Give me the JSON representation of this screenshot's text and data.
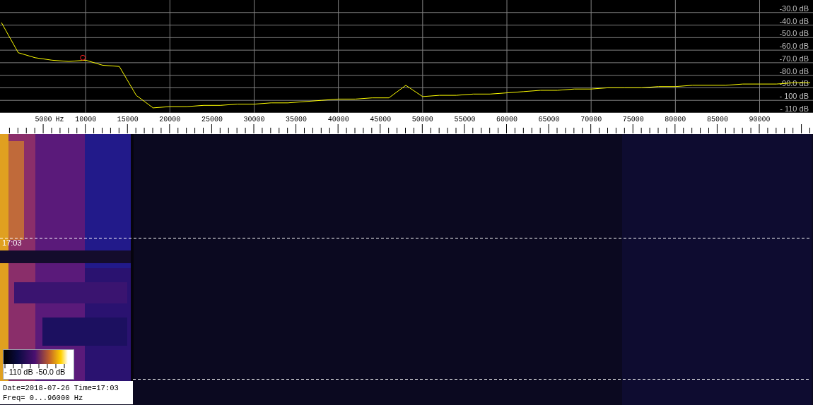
{
  "spectrum": {
    "chart_data": {
      "type": "line",
      "xlabel": "Hz",
      "x": [
        0,
        2000,
        4000,
        6000,
        8000,
        10000,
        12000,
        14000,
        16000,
        18000,
        20000,
        22000,
        24000,
        26000,
        28000,
        30000,
        32000,
        34000,
        36000,
        38000,
        40000,
        42000,
        44000,
        46000,
        48000,
        50000,
        52000,
        54000,
        56000,
        58000,
        60000,
        62000,
        64000,
        66000,
        68000,
        70000,
        72000,
        74000,
        76000,
        78000,
        80000,
        82000,
        84000,
        86000,
        88000,
        90000,
        92000,
        94000,
        96000
      ],
      "series": [
        {
          "color": "#ffff00",
          "values": [
            -38,
            -62,
            -66,
            -68,
            -69,
            -68,
            -72,
            -73,
            -96,
            -106,
            -105,
            -105,
            -104,
            -104,
            -103,
            -103,
            -102,
            -102,
            -101,
            -100,
            -99,
            -99,
            -98,
            -98,
            -88,
            -97,
            -96,
            -96,
            -95,
            -95,
            -94,
            -93,
            -92,
            -92,
            -91,
            -91,
            -90,
            -90,
            -90,
            -89,
            -89,
            -88,
            -88,
            -88,
            -87,
            -87,
            -87,
            -86,
            -86
          ]
        }
      ],
      "grid": true,
      "xlim": [
        0,
        96000
      ],
      "ylim": [
        -110,
        -20
      ],
      "xticks": [
        {
          "value": 5000,
          "label": "5000"
        },
        {
          "value": 10000,
          "label": "10000"
        },
        {
          "value": 15000,
          "label": "15000"
        },
        {
          "value": 20000,
          "label": "20000"
        },
        {
          "value": 25000,
          "label": "25000"
        },
        {
          "value": 30000,
          "label": "30000"
        },
        {
          "value": 35000,
          "label": "35000"
        },
        {
          "value": 40000,
          "label": "40000"
        },
        {
          "value": 45000,
          "label": "45000"
        },
        {
          "value": 50000,
          "label": "50000"
        },
        {
          "value": 55000,
          "label": "55000"
        },
        {
          "value": 60000,
          "label": "60000"
        },
        {
          "value": 65000,
          "label": "65000"
        },
        {
          "value": 70000,
          "label": "70000"
        },
        {
          "value": 75000,
          "label": "75000"
        },
        {
          "value": 80000,
          "label": "80000"
        },
        {
          "value": 85000,
          "label": "85000"
        },
        {
          "value": 90000,
          "label": "90000"
        }
      ],
      "yticks": [
        {
          "value": -30,
          "label": "-30.0 dB"
        },
        {
          "value": -40,
          "label": "-40.0 dB"
        },
        {
          "value": -50,
          "label": "-50.0 dB"
        },
        {
          "value": -60,
          "label": "-60.0 dB"
        },
        {
          "value": -70,
          "label": "-70.0 dB"
        },
        {
          "value": -80,
          "label": "-80.0 dB"
        },
        {
          "value": -90,
          "label": "-90.0 dB"
        },
        {
          "value": -100,
          "label": "- 100 dB"
        },
        {
          "value": -110,
          "label": "- 110 dB"
        }
      ]
    }
  },
  "waterfall": {
    "time_label": "17:03",
    "colorbar": {
      "min_label": "- 110 dB",
      "max_label": "-50.0 dB"
    }
  },
  "info": {
    "lines": [
      "Date=2018-07-26 Time=17:03",
      "Freq= 0...96000 Hz"
    ]
  }
}
